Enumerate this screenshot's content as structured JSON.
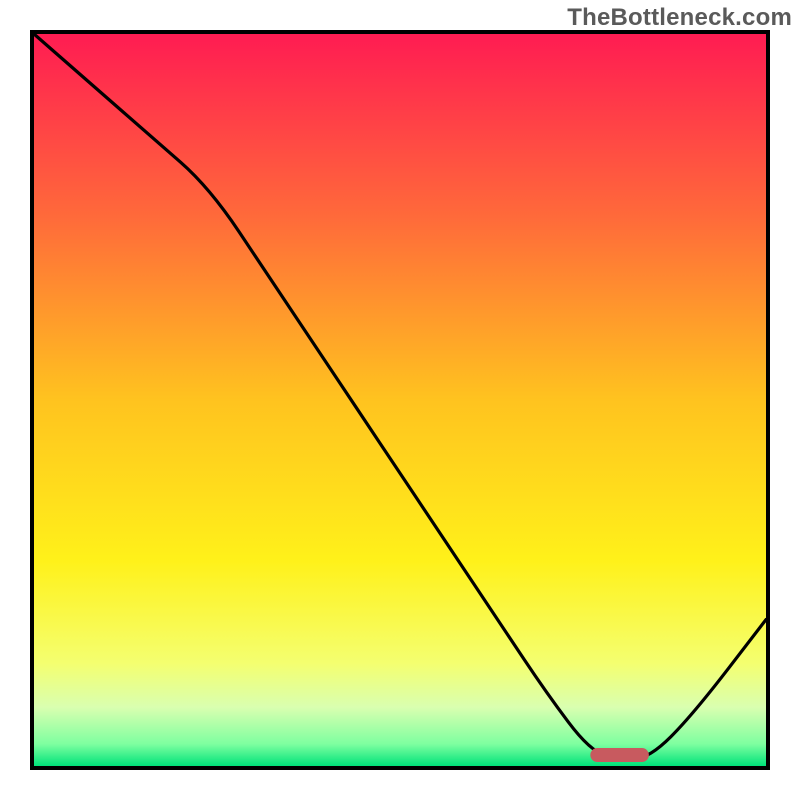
{
  "watermark": "TheBottleneck.com",
  "chart_data": {
    "type": "line",
    "title": "",
    "xlabel": "",
    "ylabel": "",
    "xlim": [
      0,
      100
    ],
    "ylim": [
      0,
      100
    ],
    "grid": false,
    "legend": false,
    "series": [
      {
        "name": "bottleneck-curve",
        "x": [
          0,
          8,
          16,
          24,
          32,
          40,
          48,
          56,
          64,
          70,
          76,
          80,
          84,
          90,
          100
        ],
        "y": [
          100,
          93,
          86,
          79,
          67,
          55,
          43,
          31,
          19,
          10,
          2,
          1,
          1,
          7,
          20
        ]
      }
    ],
    "annotations": [
      {
        "name": "optimal-marker",
        "x_start": 76,
        "x_end": 84,
        "y": 1.5,
        "color": "#c85a5f"
      }
    ],
    "background_gradient": {
      "stops": [
        {
          "offset": 0.0,
          "color": "#ff1c52"
        },
        {
          "offset": 0.25,
          "color": "#ff6a3a"
        },
        {
          "offset": 0.5,
          "color": "#ffc31f"
        },
        {
          "offset": 0.72,
          "color": "#fff11a"
        },
        {
          "offset": 0.86,
          "color": "#f4ff70"
        },
        {
          "offset": 0.92,
          "color": "#d9ffb0"
        },
        {
          "offset": 0.97,
          "color": "#7effa0"
        },
        {
          "offset": 1.0,
          "color": "#00e27a"
        }
      ]
    }
  }
}
